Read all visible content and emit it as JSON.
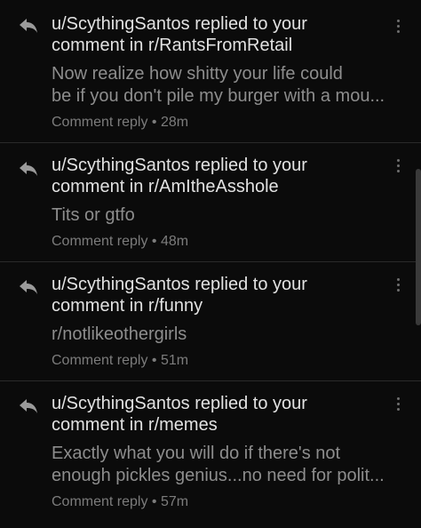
{
  "notifications": [
    {
      "title_line1": "u/ScythingSantos replied to your",
      "title_line2": "comment in r/RantsFromRetail",
      "body_line1": "Now realize how shitty your life could",
      "body_line2": "be if you don't pile my burger with a mou...",
      "meta": "Comment reply • 28m",
      "icon": "reply-icon",
      "menu_icon": "more-vertical-icon"
    },
    {
      "title_line1": "u/ScythingSantos replied to your",
      "title_line2": "comment in r/AmItheAsshole",
      "body_line1": "Tits or gtfo",
      "body_line2": "",
      "meta": "Comment reply • 48m",
      "icon": "reply-icon",
      "menu_icon": "more-vertical-icon"
    },
    {
      "title_line1": "u/ScythingSantos replied to your",
      "title_line2": "comment in r/funny",
      "body_line1": "r/notlikeothergirls",
      "body_line2": "",
      "meta": "Comment reply • 51m",
      "icon": "reply-icon",
      "menu_icon": "more-vertical-icon"
    },
    {
      "title_line1": "u/ScythingSantos replied to your",
      "title_line2": "comment in r/memes",
      "body_line1": "Exactly what you will do if there's not",
      "body_line2": "enough pickles genius...no need for polit...",
      "meta": "Comment reply • 57m",
      "icon": "reply-icon",
      "menu_icon": "more-vertical-icon"
    }
  ],
  "colors": {
    "background": "#0b0b0b",
    "title_text": "#e2e2e2",
    "body_text": "#8d8d8d",
    "meta_text": "#7c7c7c",
    "divider": "#2a2a2a"
  }
}
